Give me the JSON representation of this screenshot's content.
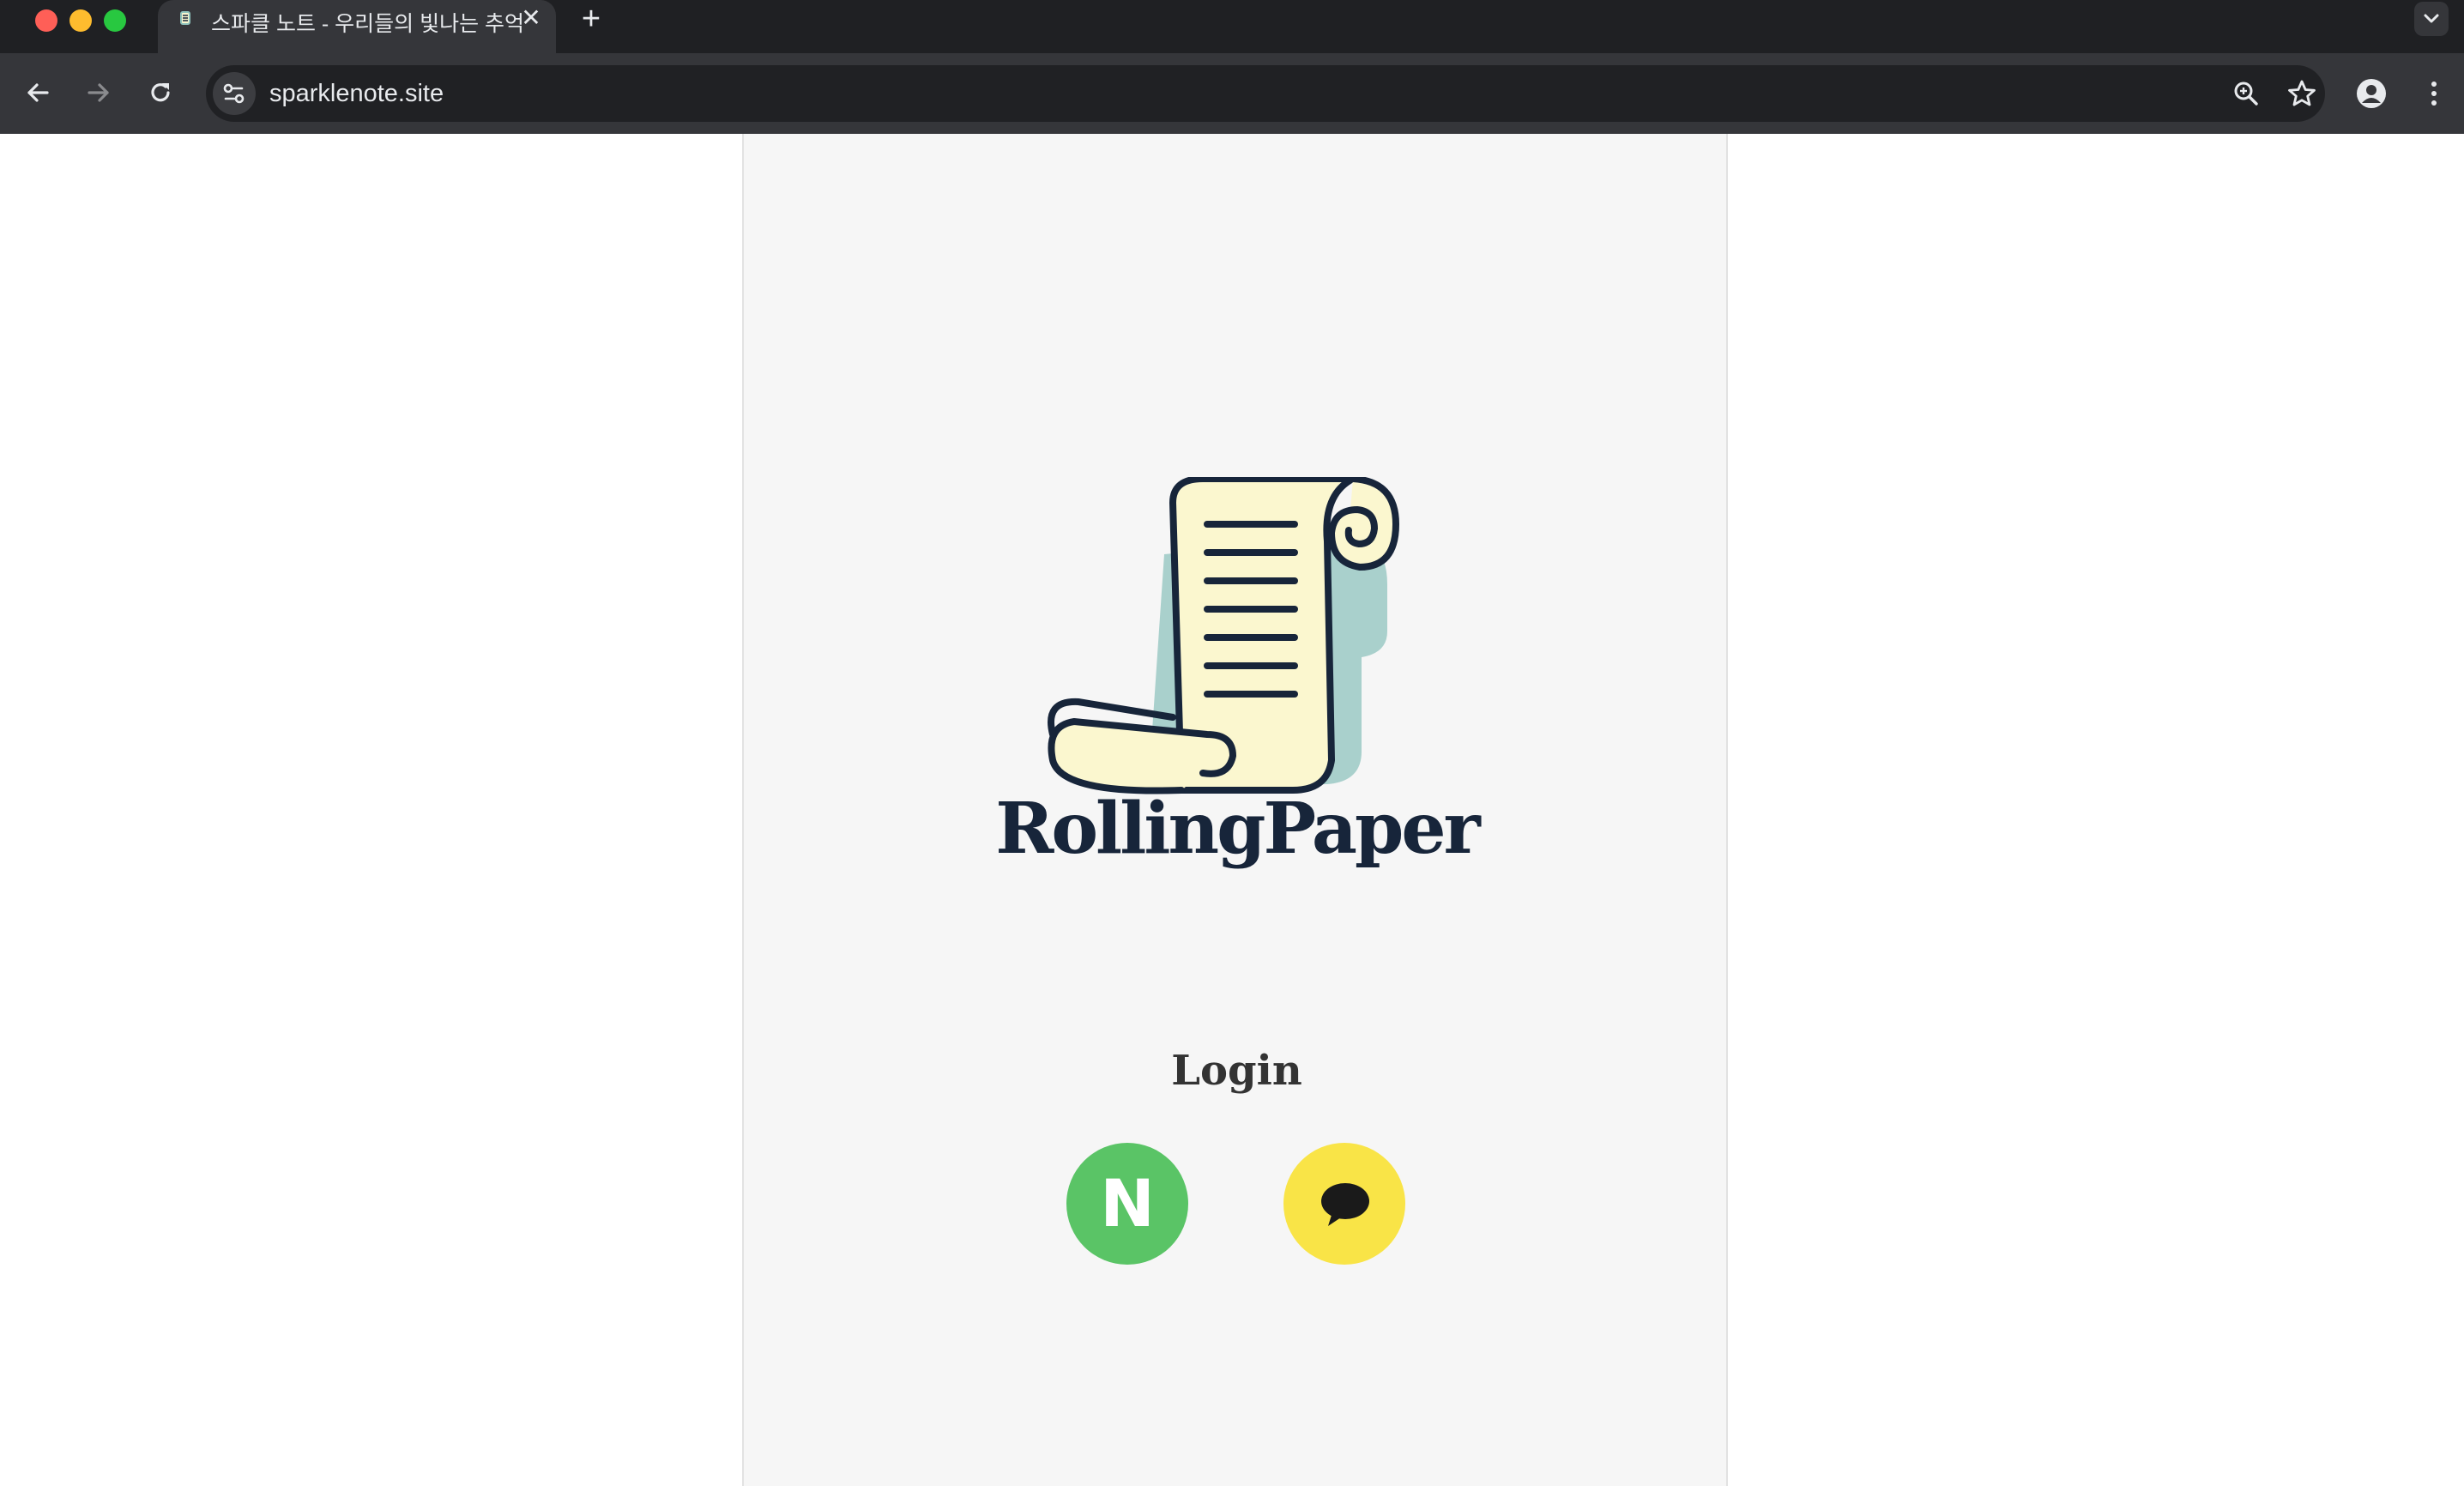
{
  "browser": {
    "tab": {
      "title": "스파클 노트 - 우리들의 빛나는 추억",
      "close_glyph": "✕"
    },
    "new_tab_glyph": "+",
    "address": {
      "url": "sparklenote.site"
    },
    "icons": {
      "back": "back-arrow-icon",
      "forward": "forward-arrow-icon",
      "reload": "reload-icon",
      "site_info": "site-settings-icon",
      "zoom": "zoom-icon",
      "bookmark": "star-icon",
      "profile": "profile-icon",
      "menu": "kebab-menu-icon",
      "tab_search": "chevron-down-icon"
    }
  },
  "page": {
    "logo": {
      "wordmark": "RollingPaper",
      "icon": "scroll-icon",
      "colors": {
        "ink": "#17253a",
        "paper": "#fbf7cf",
        "shadow": "#8fc3bd"
      }
    },
    "login": {
      "heading": "Login",
      "buttons": [
        {
          "provider": "naver",
          "glyph": "N",
          "color": "#5ac466"
        },
        {
          "provider": "kakao",
          "icon": "speech-bubble-icon",
          "color": "#f9e447"
        }
      ]
    }
  }
}
